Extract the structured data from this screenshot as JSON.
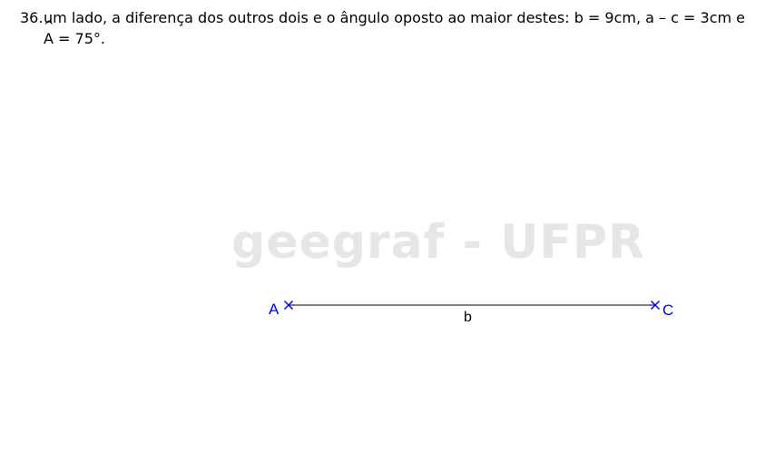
{
  "problem": {
    "number": "36.",
    "line1": "um lado, a diferença dos outros dois e o ângulo oposto ao maior destes: b = 9cm, a – c = 3cm e",
    "angle_letter": "A",
    "angle_hat": "^",
    "line2_rest": " = 75°."
  },
  "watermark": "geegraf - UFPR",
  "figure": {
    "point_a": "A",
    "point_c": "C",
    "segment_b": "b",
    "colors": {
      "points": "#0000ff",
      "segment": "#000000",
      "watermark": "#e6e6e6"
    }
  }
}
